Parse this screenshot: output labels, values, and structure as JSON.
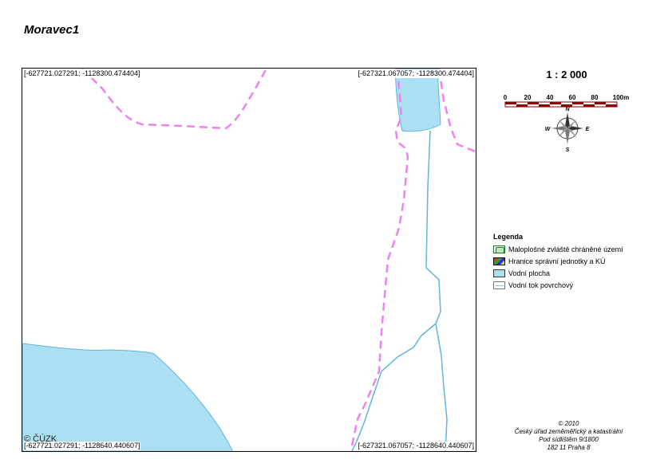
{
  "title": "Moravec1",
  "map": {
    "coord_top_left": "[-627721.027291; -1128300.474404]",
    "coord_top_right": "[-627321.067057; -1128300.474404]",
    "coord_bottom_left": "[-627721.027291; -1128640.440607]",
    "coord_bottom_right": "[-627321.067057; -1128640.440607]",
    "copyright": "© ČÚZK",
    "colors": {
      "water": "#abe0f2",
      "stream": "#5fb4e0",
      "boundary": "#ee82ee"
    }
  },
  "scale": {
    "label": "1 : 2 000",
    "ticks": [
      "0",
      "20",
      "40",
      "60",
      "80",
      "100m"
    ]
  },
  "north_arrow": {
    "n": "N",
    "e": "E",
    "s": "S",
    "w": "W"
  },
  "legend": {
    "title": "Legenda",
    "items": [
      {
        "label": "Maloplošné zvláště chráněné území",
        "icon": "protected-area-symbol"
      },
      {
        "label": "Hranice správní jednotky a KÚ",
        "icon": "admin-boundary-symbol"
      },
      {
        "label": "Vodní plocha",
        "icon": "water-area-symbol"
      },
      {
        "label": "Vodní tok povrchový",
        "icon": "surface-stream-symbol"
      }
    ]
  },
  "footer": {
    "line1": "© 2010",
    "line2": "Český úřad zeměměřický a katastrální",
    "line3": "Pod sídlištěm 9/1800",
    "line4": "182 11 Praha 8"
  }
}
